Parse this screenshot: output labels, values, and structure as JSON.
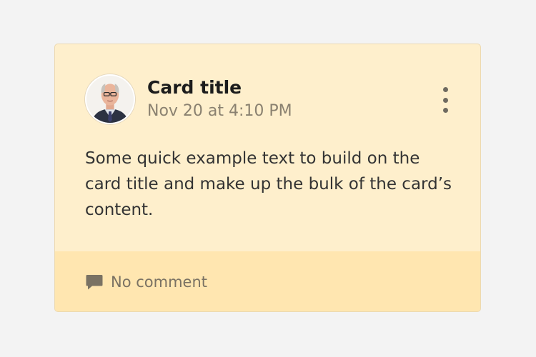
{
  "card": {
    "title": "Card title",
    "subtitle": "Nov 20 at 4:10 PM",
    "text": "Some quick example text to build on the card title and make up the bulk of the card’s content.",
    "footer": {
      "comment_label": "No comment",
      "comment_icon": "comment-icon"
    },
    "menu_icon": "more-vertical-icon",
    "avatar_icon": "user-avatar"
  },
  "colors": {
    "card_background": "#feefcc",
    "footer_background": "#ffe6b0",
    "page_background": "#f3f3f3"
  }
}
